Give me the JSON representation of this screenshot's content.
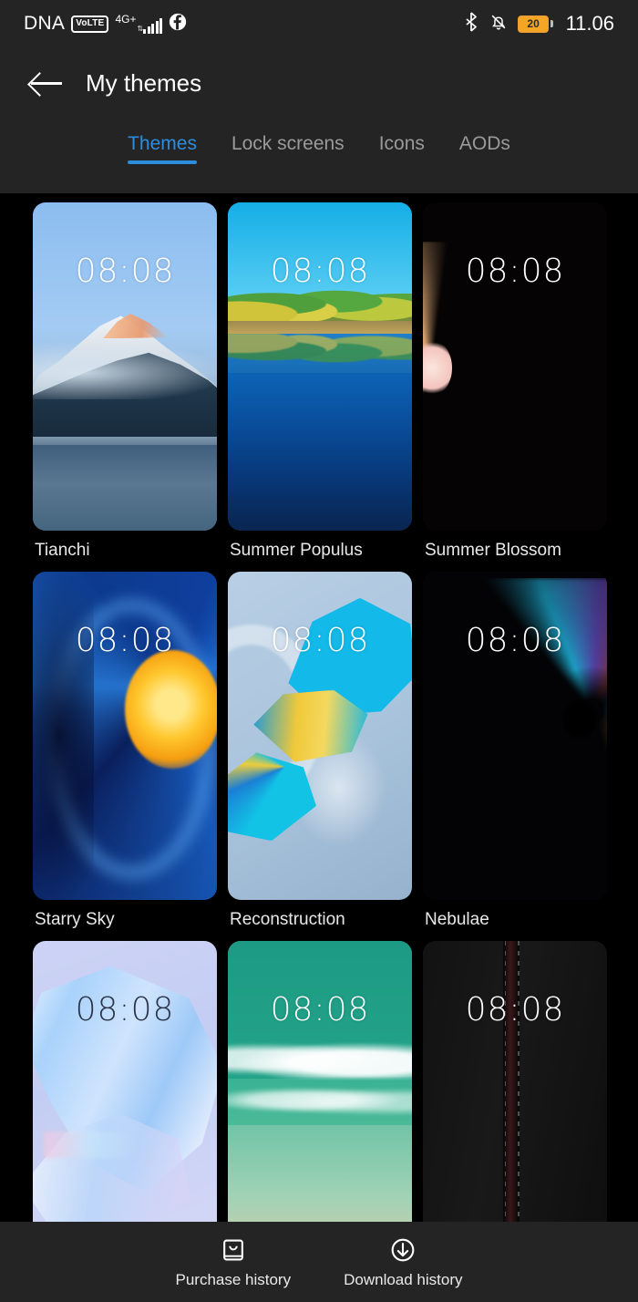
{
  "status_bar": {
    "carrier": "DNA",
    "volte_badge": "VoLTE",
    "network_type": "4G+",
    "signal_icon": "signal-bars-icon",
    "app_icon": "facebook-icon",
    "bluetooth_icon": "bluetooth-icon",
    "silent_icon": "bell-muted-icon",
    "battery_level": "20",
    "battery_icon": "battery-icon",
    "time": "11.06"
  },
  "header": {
    "back_icon": "back-arrow-icon",
    "title": "My themes"
  },
  "tabs": [
    {
      "label": "Themes",
      "active": true
    },
    {
      "label": "Lock screens",
      "active": false
    },
    {
      "label": "Icons",
      "active": false
    },
    {
      "label": "AODs",
      "active": false
    }
  ],
  "themes": [
    {
      "name": "Tianchi",
      "clock": "08:08",
      "art": "art-tianchi",
      "dark_clock": false
    },
    {
      "name": "Summer Populus",
      "clock": "08:08",
      "art": "art-populus",
      "dark_clock": false
    },
    {
      "name": "Summer Blossom",
      "clock": "08:08",
      "art": "art-blossom",
      "dark_clock": false
    },
    {
      "name": "Starry Sky",
      "clock": "08:08",
      "art": "art-starry",
      "dark_clock": false
    },
    {
      "name": "Reconstruction",
      "clock": "08:08",
      "art": "art-recon",
      "dark_clock": false
    },
    {
      "name": "Nebulae",
      "clock": "08:08",
      "art": "art-nebulae",
      "dark_clock": false
    },
    {
      "name": "",
      "clock": "08:08",
      "art": "art-silk",
      "dark_clock": true
    },
    {
      "name": "",
      "clock": "08:08",
      "art": "art-ocean",
      "dark_clock": false
    },
    {
      "name": "",
      "clock": "08:08",
      "art": "art-leather",
      "dark_clock": false
    }
  ],
  "bottom_bar": [
    {
      "label": "Purchase history",
      "icon": "shopping-bag-icon"
    },
    {
      "label": "Download history",
      "icon": "download-arrow-icon"
    }
  ],
  "colors": {
    "accent": "#2c8dde",
    "bar_background": "#242424",
    "page_background": "#000000",
    "battery_warning": "#f5a623"
  }
}
